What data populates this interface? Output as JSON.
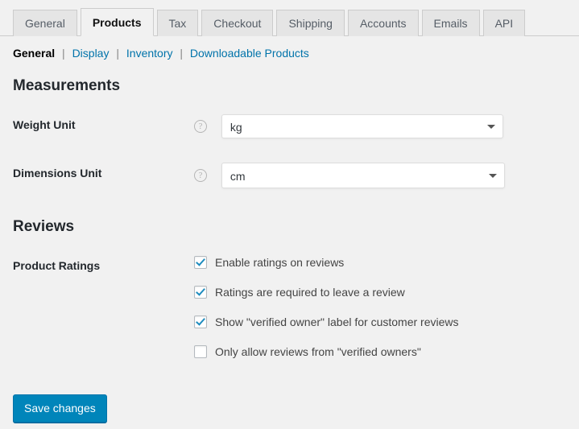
{
  "tabs": [
    {
      "label": "General",
      "active": false
    },
    {
      "label": "Products",
      "active": true
    },
    {
      "label": "Tax",
      "active": false
    },
    {
      "label": "Checkout",
      "active": false
    },
    {
      "label": "Shipping",
      "active": false
    },
    {
      "label": "Accounts",
      "active": false
    },
    {
      "label": "Emails",
      "active": false
    },
    {
      "label": "API",
      "active": false
    }
  ],
  "subnav": {
    "items": [
      {
        "label": "General",
        "current": true
      },
      {
        "label": "Display",
        "current": false
      },
      {
        "label": "Inventory",
        "current": false
      },
      {
        "label": "Downloadable Products",
        "current": false
      }
    ],
    "separator": "|"
  },
  "sections": {
    "measurements": {
      "title": "Measurements",
      "weight_unit": {
        "label": "Weight Unit",
        "help_icon": "help-question-icon",
        "help_glyph": "?",
        "value": "kg"
      },
      "dimensions_unit": {
        "label": "Dimensions Unit",
        "help_icon": "help-question-icon",
        "help_glyph": "?",
        "value": "cm"
      }
    },
    "reviews": {
      "title": "Reviews",
      "product_ratings": {
        "label": "Product Ratings",
        "options": [
          {
            "label": "Enable ratings on reviews",
            "checked": true
          },
          {
            "label": "Ratings are required to leave a review",
            "checked": true
          },
          {
            "label": "Show \"verified owner\" label for customer reviews",
            "checked": true
          },
          {
            "label": "Only allow reviews from \"verified owners\"",
            "checked": false
          }
        ]
      }
    }
  },
  "actions": {
    "save_label": "Save changes"
  },
  "colors": {
    "accent": "#0085ba",
    "link": "#0073aa",
    "check": "#1e8cbe",
    "page_bg": "#f1f1f1",
    "tab_inactive_bg": "#e5e5e5"
  }
}
